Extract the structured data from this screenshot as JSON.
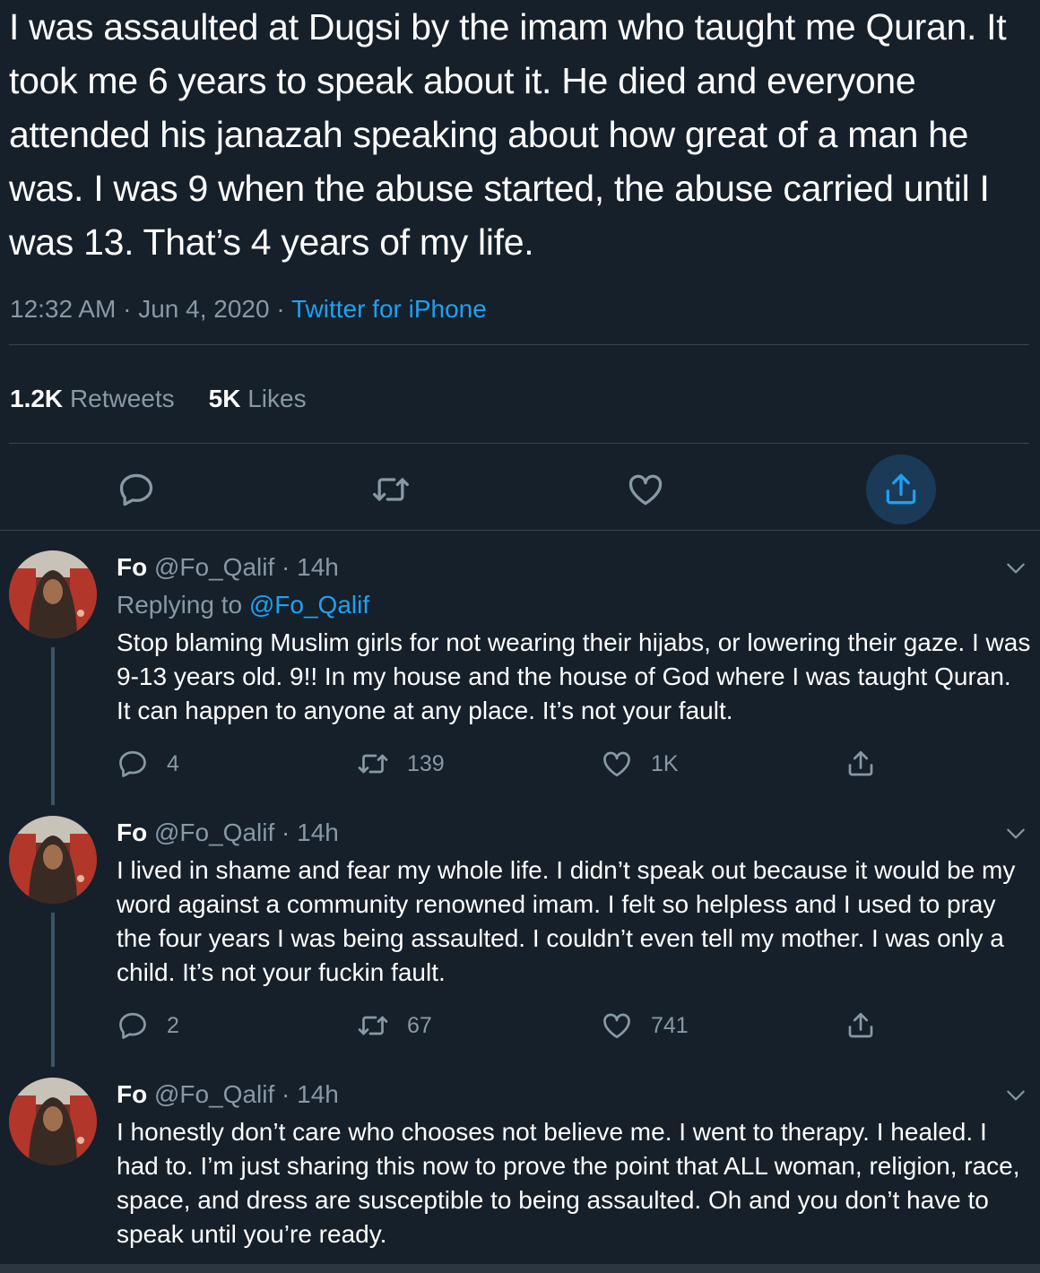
{
  "tweet": {
    "text": "I was assaulted at Dugsi by the imam who taught me Quran. It took me 6 years to speak about it. He died and everyone attended his janazah speaking about how great of a man he was. I was 9 when the abuse started, the abuse carried until I was 13. That’s 4 years of my life.",
    "time": "12:32 AM",
    "date": "Jun 4, 2020",
    "source": "Twitter for iPhone",
    "retweets_count": "1.2K",
    "retweets_label": "Retweets",
    "likes_count": "5K",
    "likes_label": "Likes"
  },
  "replies": [
    {
      "name": "Fo",
      "handle": "@Fo_Qalif",
      "time": "14h",
      "replying_label": "Replying to",
      "replying_handle": "@Fo_Qalif",
      "text": "Stop blaming Muslim girls for not wearing their hijabs, or lowering their gaze. I was 9-13 years old. 9!! In my house and the house of God where I was taught Quran. It can happen to anyone at any place. It’s not your fault.",
      "reply_count": "4",
      "retweet_count": "139",
      "like_count": "1K"
    },
    {
      "name": "Fo",
      "handle": "@Fo_Qalif",
      "time": "14h",
      "text": "I lived in shame and fear my whole life. I didn’t speak out because it would be my word against a community renowned imam. I felt so helpless and I used to pray the four years I was being assaulted. I couldn’t even tell my mother. I was only a child. It’s not your fuckin fault.",
      "reply_count": "2",
      "retweet_count": "67",
      "like_count": "741"
    },
    {
      "name": "Fo",
      "handle": "@Fo_Qalif",
      "time": "14h",
      "text": "I honestly don’t care who chooses not believe me. I went to therapy. I healed. I had to. I’m just sharing this now to prove the point that ALL woman, religion, race, space, and dress are susceptible to being assaulted. Oh and you don’t have to speak until you’re ready."
    }
  ],
  "colors": {
    "background": "#15202b",
    "text": "#ffffff",
    "muted": "#8899a6",
    "accent": "#1da1f2",
    "divider": "#38444d"
  },
  "icons": [
    "reply-icon",
    "retweet-icon",
    "like-icon",
    "share-icon",
    "chevron-down-icon"
  ]
}
